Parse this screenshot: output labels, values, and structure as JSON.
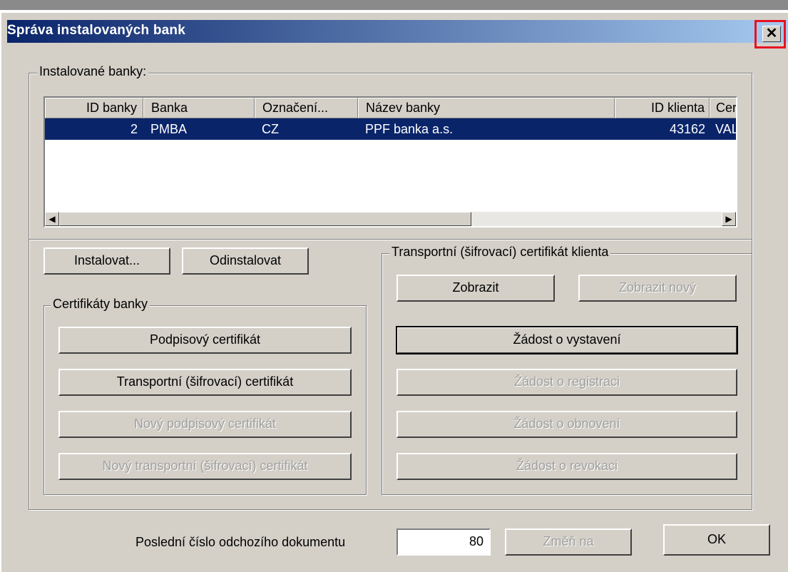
{
  "window": {
    "title": "Správa instalovaných bank",
    "close_glyph": "✕"
  },
  "installed_banks": {
    "label": "Instalované banky:",
    "columns": [
      "ID banky",
      "Banka",
      "Označení...",
      "Název banky",
      "ID klienta",
      "Certi"
    ],
    "rows": [
      {
        "id": "2",
        "bank": "PMBA",
        "code": "CZ",
        "name": "PPF banka a.s.",
        "client_id": "43162",
        "cert": "VAL"
      }
    ],
    "scroll_left": "◀",
    "scroll_right": "▶"
  },
  "buttons": {
    "install": "Instalovat...",
    "uninstall": "Odinstalovat"
  },
  "bank_certificates": {
    "label": "Certifikáty banky",
    "signing": "Podpisový certifikát",
    "transport": "Transportní (šifrovací) certifikát",
    "new_signing": "Nový podpisový certifikát",
    "new_transport": "Nový transportní (šifrovací) certifikát"
  },
  "client_cert": {
    "label": "Transportní (šifrovací) certifikát klienta",
    "show": "Zobrazit",
    "show_new": "Zobrazit nový",
    "request_issue": "Žádost o vystavení",
    "request_register": "Žádost o registraci",
    "request_renew": "Žádost o obnovení",
    "request_revoke": "Žádost o revokaci"
  },
  "footer": {
    "last_doc_label": "Poslední číslo odchozího dokumentu",
    "last_doc_value": "80",
    "change_to": "Změň na",
    "ok": "OK"
  }
}
